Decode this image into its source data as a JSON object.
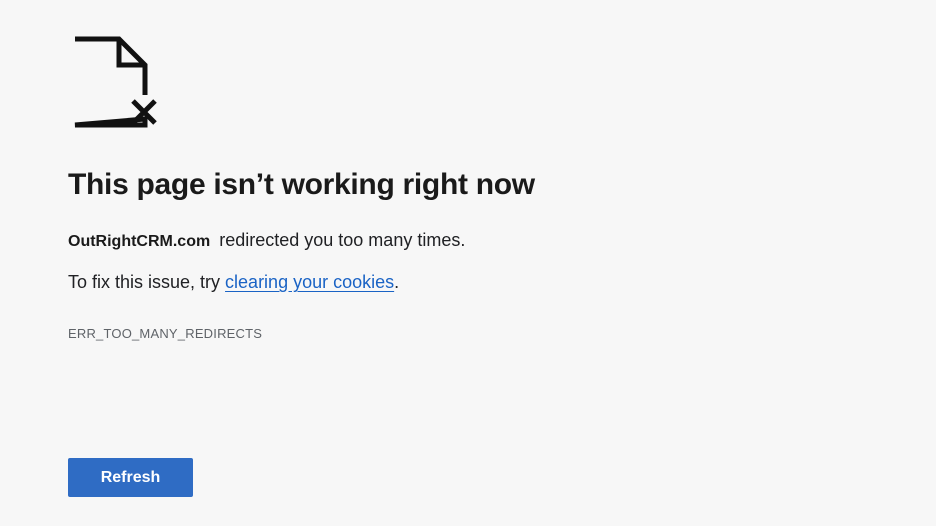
{
  "icons": {
    "error_icon": "broken-page-icon"
  },
  "error": {
    "title": "This page isn’t working right now",
    "domain": "OutRightCRM.com",
    "message": "redirected you too many times.",
    "fix_prefix": "To fix this issue, try ",
    "fix_link": "clearing your cookies",
    "fix_suffix": ".",
    "code": "ERR_TOO_MANY_REDIRECTS"
  },
  "actions": {
    "refresh_label": "Refresh"
  },
  "colors": {
    "background": "#f7f7f7",
    "link": "#1a63c5",
    "button": "#2f6cc4"
  }
}
